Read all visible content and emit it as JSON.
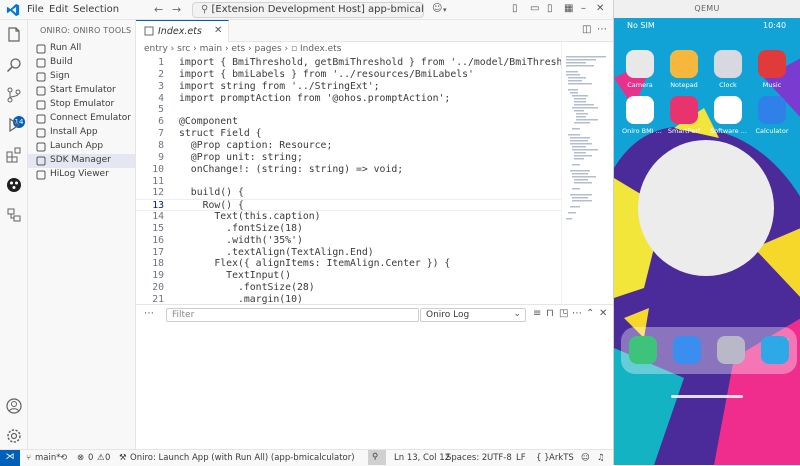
{
  "titlebar": {
    "menu": [
      "File",
      "Edit",
      "Selection"
    ],
    "command_center": "[Extension Development Host] app-bmicalculator"
  },
  "activity": {
    "scm_badge": "14"
  },
  "sidebar": {
    "title": "ONIRO: ONIRO TOOLS",
    "items": [
      {
        "label": "Run All",
        "icon": "run-all-icon"
      },
      {
        "label": "Build",
        "icon": "build-icon"
      },
      {
        "label": "Sign",
        "icon": "sign-icon"
      },
      {
        "label": "Start Emulator",
        "icon": "start-emulator-icon"
      },
      {
        "label": "Stop Emulator",
        "icon": "stop-emulator-icon"
      },
      {
        "label": "Connect Emulator",
        "icon": "connect-emulator-icon"
      },
      {
        "label": "Install App",
        "icon": "install-app-icon"
      },
      {
        "label": "Launch App",
        "icon": "launch-app-icon"
      },
      {
        "label": "SDK Manager",
        "icon": "sdk-manager-icon"
      },
      {
        "label": "HiLog Viewer",
        "icon": "hilog-viewer-icon"
      }
    ]
  },
  "editor": {
    "tab_label": "Index.ets",
    "breadcrumb": [
      "entry",
      "src",
      "main",
      "ets",
      "pages",
      "Index.ets"
    ],
    "current_line": 13,
    "lines": [
      {
        "n": "1",
        "text": "import { BmiThreshold, getBmiThreshold } from '../model/BmiThreshold'"
      },
      {
        "n": "2",
        "text": "import { bmiLabels } from '../resources/BmiLabels'"
      },
      {
        "n": "3",
        "text": "import string from '../StringExt';"
      },
      {
        "n": "4",
        "text": "import promptAction from '@ohos.promptAction';"
      },
      {
        "n": "5",
        "text": ""
      },
      {
        "n": "6",
        "text": "@Component"
      },
      {
        "n": "7",
        "text": "struct Field {"
      },
      {
        "n": "8",
        "text": "  @Prop caption: Resource;"
      },
      {
        "n": "9",
        "text": "  @Prop unit: string;"
      },
      {
        "n": "10",
        "text": "  onChange!: (string: string) => void;"
      },
      {
        "n": "11",
        "text": ""
      },
      {
        "n": "12",
        "text": "  build() {"
      },
      {
        "n": "13",
        "text": "    Row() {"
      },
      {
        "n": "14",
        "text": "      Text(this.caption)"
      },
      {
        "n": "15",
        "text": "        .fontSize(18)"
      },
      {
        "n": "16",
        "text": "        .width('35%')"
      },
      {
        "n": "17",
        "text": "        .textAlign(TextAlign.End)"
      },
      {
        "n": "18",
        "text": "      Flex({ alignItems: ItemAlign.Center }) {"
      },
      {
        "n": "19",
        "text": "        TextInput()"
      },
      {
        "n": "20",
        "text": "          .fontSize(28)"
      },
      {
        "n": "21",
        "text": "          .margin(10)"
      }
    ]
  },
  "panel": {
    "filter_placeholder": "Filter",
    "log_channel": "Oniro Log"
  },
  "statusbar": {
    "branch": "main*",
    "errors": "0",
    "warnings": "0",
    "task": "Oniro: Launch App (with Run All) (app-bmicalculator)",
    "position": "Ln 13, Col 12",
    "spaces": "Spaces: 2",
    "encoding": "UTF-8",
    "eol": "LF",
    "language": "ArkTS"
  },
  "qemu": {
    "title": "QEMU",
    "sim": "No SIM",
    "time": "10:40",
    "apps": [
      {
        "label": "Camera",
        "color": "#e8e8e8"
      },
      {
        "label": "Notepad",
        "color": "#f5b83d"
      },
      {
        "label": "Clock",
        "color": "#d8d8e0"
      },
      {
        "label": "Music",
        "color": "#e03a3a"
      },
      {
        "label": "Oniro BMI ...",
        "color": "#ffffff"
      },
      {
        "label": "SmartPerf",
        "color": "#e8336e"
      },
      {
        "label": "Software ...",
        "color": "#ffffff"
      },
      {
        "label": "Calculator",
        "color": "#2f80e8"
      }
    ],
    "dock_colors": [
      "#3dc47a",
      "#3a8ef0",
      "#b8b8c8",
      "#2fa8e8"
    ]
  }
}
